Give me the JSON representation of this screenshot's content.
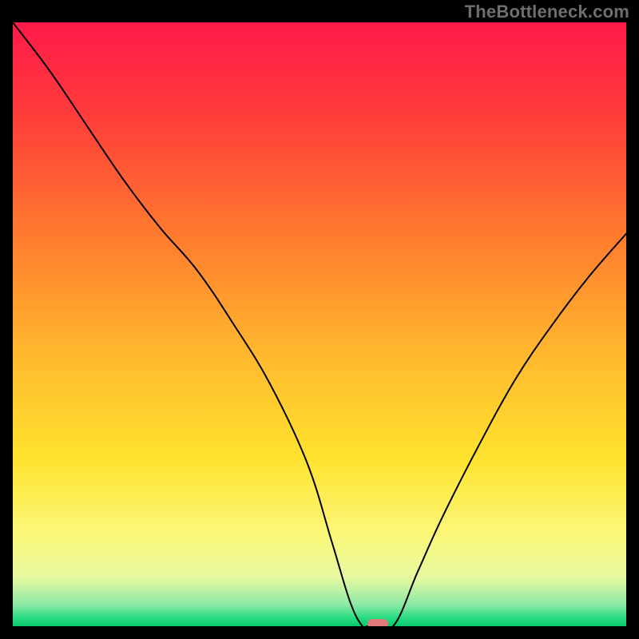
{
  "watermark": "TheBottleneck.com",
  "chart_data": {
    "type": "line",
    "title": "",
    "xlabel": "",
    "ylabel": "",
    "xlim": [
      0,
      100
    ],
    "ylim": [
      0,
      100
    ],
    "grid": false,
    "legend": false,
    "background_gradient": {
      "stops": [
        {
          "pct": 0.0,
          "color": "#ff1a4a"
        },
        {
          "pct": 0.15,
          "color": "#ff3b3b"
        },
        {
          "pct": 0.35,
          "color": "#ff7a2e"
        },
        {
          "pct": 0.55,
          "color": "#ffb82e"
        },
        {
          "pct": 0.72,
          "color": "#ffe22e"
        },
        {
          "pct": 0.85,
          "color": "#fbf87a"
        },
        {
          "pct": 0.92,
          "color": "#e6f9a1"
        },
        {
          "pct": 0.965,
          "color": "#8be9a7"
        },
        {
          "pct": 0.985,
          "color": "#2bdc82"
        },
        {
          "pct": 1.0,
          "color": "#08c96f"
        }
      ]
    },
    "series": [
      {
        "name": "bottleneck-curve",
        "x": [
          0,
          6,
          12,
          18,
          24,
          30,
          36,
          42,
          48,
          52,
          55,
          57,
          58,
          62,
          66,
          70,
          76,
          82,
          88,
          94,
          100
        ],
        "y": [
          100,
          92,
          83,
          74,
          66,
          59,
          50,
          40,
          27,
          14,
          4,
          0,
          0,
          0,
          9,
          18,
          30,
          41,
          50,
          58,
          65
        ]
      }
    ],
    "marker": {
      "x": 59.5,
      "y": 0,
      "shape": "rounded-rect",
      "color": "#e07a7a"
    }
  }
}
